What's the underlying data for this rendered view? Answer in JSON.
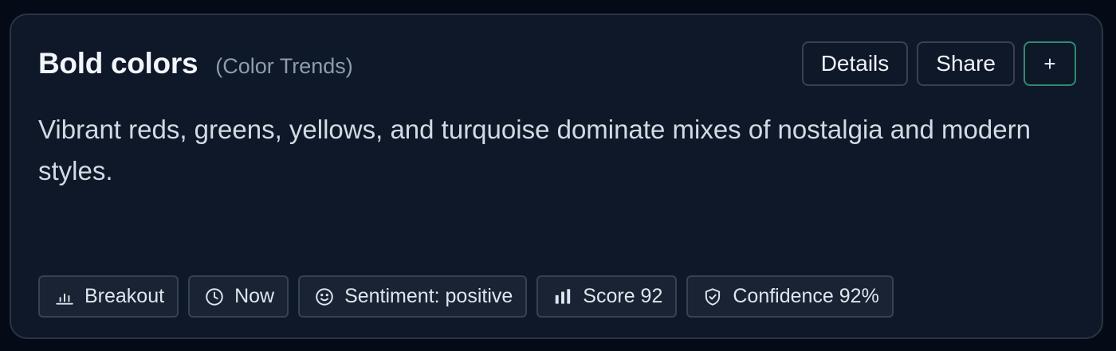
{
  "card": {
    "title": "Bold colors",
    "category": "(Color Trends)",
    "description": "Vibrant reds, greens, yellows, and turquoise dominate mixes of nostalgia and modern styles."
  },
  "actions": {
    "details_label": "Details",
    "share_label": "Share",
    "add_label": "+"
  },
  "chips": [
    {
      "icon": "bar-chart-outline-icon",
      "label": "Breakout"
    },
    {
      "icon": "clock-icon",
      "label": "Now"
    },
    {
      "icon": "smiley-icon",
      "label": "Sentiment: positive"
    },
    {
      "icon": "bar-chart-filled-icon",
      "label": "Score 92"
    },
    {
      "icon": "shield-check-icon",
      "label": "Confidence 92%"
    }
  ],
  "colors": {
    "background": "#050a17",
    "card": "#0f1828",
    "add_button_border": "#2f8a72"
  }
}
